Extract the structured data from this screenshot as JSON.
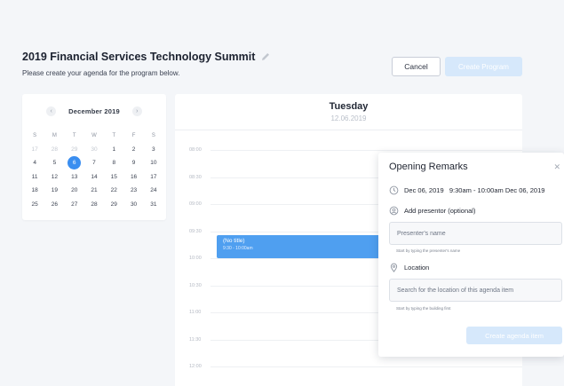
{
  "header": {
    "title": "2019 Financial Services Technology Summit",
    "subtitle": "Please create your agenda for the program below."
  },
  "actions": {
    "cancel_label": "Cancel",
    "create_program_label": "Create Program"
  },
  "mini_calendar": {
    "month_label": "December 2019",
    "prev_icon": "chevron-left-icon",
    "next_icon": "chevron-right-icon",
    "weekdays": [
      "S",
      "M",
      "T",
      "W",
      "T",
      "F",
      "S"
    ],
    "weeks": [
      [
        "24",
        "25",
        "26",
        "27",
        "28",
        "29",
        "30"
      ],
      [
        "1",
        "2",
        "3",
        "4",
        "5",
        "6",
        "7"
      ],
      [
        "8",
        "9",
        "10",
        "11",
        "12",
        "13",
        "14"
      ],
      [
        "15",
        "16",
        "17",
        "18",
        "19",
        "20",
        "21"
      ],
      [
        "22",
        "23",
        "24",
        "25",
        "26",
        "27",
        "28"
      ],
      [
        "29",
        "30",
        "31",
        "",
        "",
        "",
        ""
      ]
    ],
    "cells": [
      [
        "S",
        "M",
        "T",
        "W",
        "T",
        "F",
        "S"
      ],
      [
        "17",
        "28",
        "29",
        "30",
        "1",
        "2",
        "3"
      ],
      [
        "4",
        "5",
        "6",
        "7",
        "8",
        "9",
        "10"
      ],
      [
        "11",
        "12",
        "13",
        "14",
        "15",
        "16",
        "17"
      ],
      [
        "18",
        "19",
        "20",
        "21",
        "22",
        "23",
        "24"
      ],
      [
        "25",
        "26",
        "27",
        "28",
        "29",
        "30",
        "31"
      ]
    ],
    "muted_first_row": [
      "17",
      "28",
      "29",
      "30"
    ],
    "selected": "6",
    "selected_color": "#3a8ef0"
  },
  "day_view": {
    "day_name": "Tuesday",
    "date": "12.06.2019",
    "slots": [
      "08:00",
      "08:30",
      "09:00",
      "09:30",
      "10:00",
      "10:30",
      "11:00",
      "11:30",
      "12:00"
    ]
  },
  "event": {
    "title": "(No title)",
    "time": "9:30 - 10:00am",
    "color": "#4f9ff0"
  },
  "popover": {
    "title": "Opening Remarks",
    "close_icon": "close-icon",
    "datetime": "Dec 06, 2019   9:30am - 10:00am Dec 06, 2019",
    "presenter_label": "Add presentor (optional)",
    "presenter_placeholder": "Presenter's name",
    "presenter_hint": "Start by typing the presenter's name",
    "location_label": "Location",
    "location_placeholder": "Search for the location of this agenda item",
    "location_hint": "Start by typing the building first",
    "create_label": "Create agenda item"
  }
}
